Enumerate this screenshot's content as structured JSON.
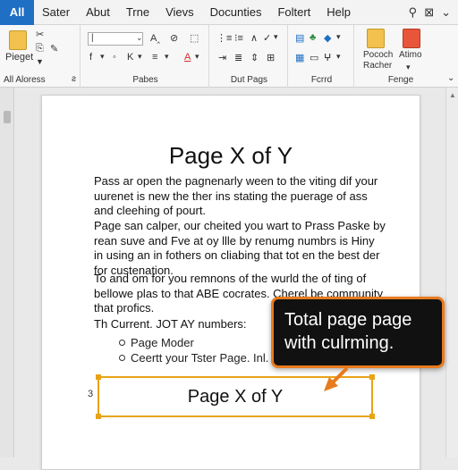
{
  "menubar": {
    "all": "All",
    "items": [
      "Sater",
      "Abut",
      "Trne",
      "Vievs",
      "Docunties",
      "Foltert",
      "Help"
    ]
  },
  "ribbon": {
    "group1": {
      "label": "All Aloress",
      "icon_label": "Pieget",
      "launcher": "ƨ"
    },
    "group2": {
      "label": "Pabes",
      "font_field": "|",
      "k_label": "K"
    },
    "group3": {
      "label": "Dut Pags"
    },
    "group4": {
      "label": "Fcrrd"
    },
    "group5": {
      "label": "Fenge",
      "btn1": [
        "Pococh",
        "Racher"
      ],
      "btn2": "Atimo"
    }
  },
  "document": {
    "title": "Page X of Y",
    "paragraphs": [
      "Pass ar open the pagnenarly ween to the viting dif your uurenet is new the ther ins stating the puerage of ass and cleehing of pourt.",
      "Page san calper, our cheited you wart to Prass Paske by rean suve and Fve at oy llle by renumg numbrs is Hiny in using an in fothers on cliabing that tot en the best der for custenation.",
      "To and om for you remnons of the wurld the of ting of bellowe plas to that ABE cocrates. Cherel be community that profics.",
      "Th Current. JOT AY numbers:"
    ],
    "bullets": [
      "Page Moder",
      "Ceertt your Tster Page. Inl."
    ],
    "selected_field": "Page X of Y",
    "margin_marker": "3"
  },
  "callout": {
    "lines": [
      "Total page page",
      "with culrming."
    ]
  },
  "colors": {
    "accent": "#1f6fc5",
    "selection": "#e8a317",
    "callout_border": "#e87b1e",
    "callout_bg": "#111111"
  }
}
